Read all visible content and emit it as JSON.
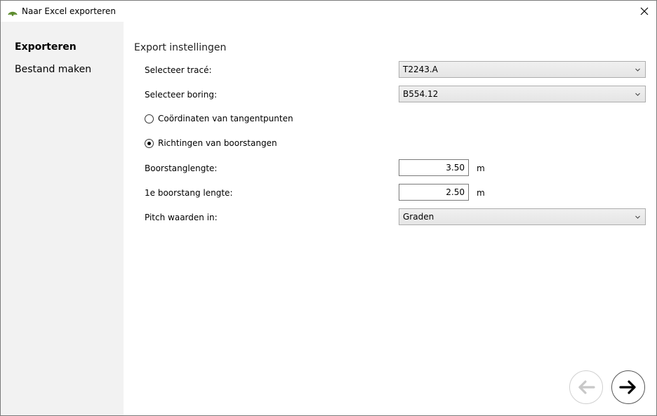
{
  "window": {
    "title": "Naar Excel exporteren",
    "icons": {
      "app": "signal-rings-icon",
      "close": "close-icon"
    }
  },
  "sidebar": {
    "items": [
      {
        "label": "Exporteren",
        "active": true
      },
      {
        "label": "Bestand maken",
        "active": false
      }
    ]
  },
  "main": {
    "section_title": "Export instellingen",
    "trace": {
      "label": "Selecteer tracé:",
      "value": "T2243.A"
    },
    "boring": {
      "label": "Selecteer boring:",
      "value": "B554.12"
    },
    "options": [
      {
        "label": "Coördinaten van tangentpunten",
        "checked": false
      },
      {
        "label": "Richtingen van boorstangen",
        "checked": true
      }
    ],
    "rod_length": {
      "label": "Boorstanglengte:",
      "value": "3.50",
      "unit": "m"
    },
    "first_rod_length": {
      "label": "1e boorstang lengte:",
      "value": "2.50",
      "unit": "m"
    },
    "pitch": {
      "label": "Pitch waarden in:",
      "value": "Graden"
    }
  },
  "navigation": {
    "back_enabled": false,
    "next_enabled": true,
    "icons": {
      "back": "arrow-left-icon",
      "next": "arrow-right-icon"
    }
  },
  "colors": {
    "sidebar_bg": "#f2f2f2",
    "app_icon_green": "#5a8a2a",
    "disabled_arrow": "#c8c8c8"
  }
}
